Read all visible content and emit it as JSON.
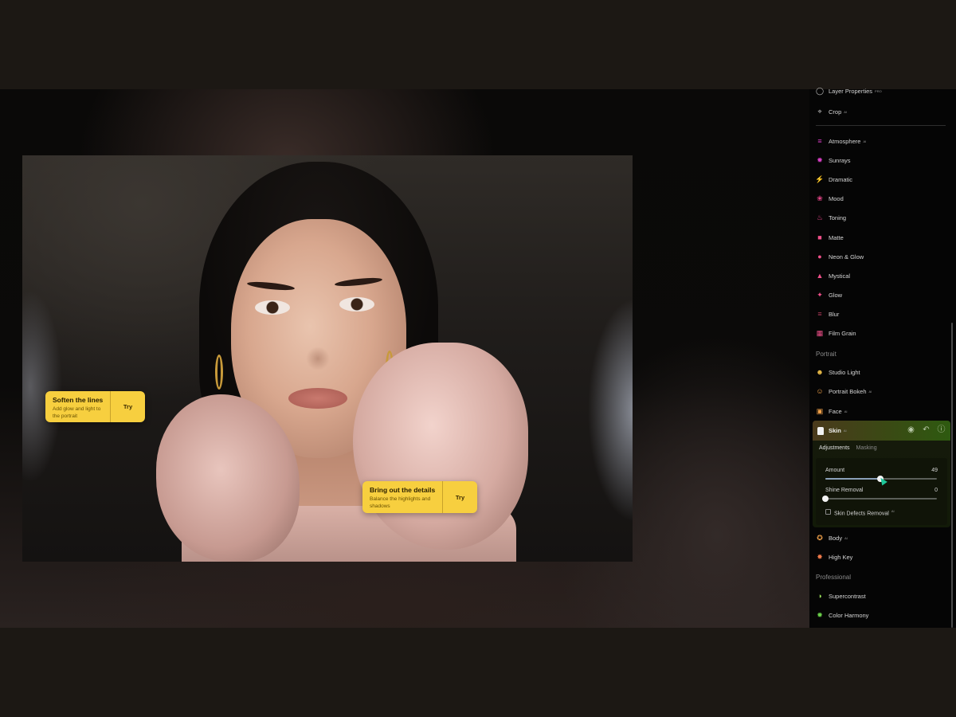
{
  "canvas": {
    "photo_alt": "Portrait of a woman with dark hair and a pink tulle ruffle dress"
  },
  "suggestions": [
    {
      "title": "Soften the lines",
      "description": "Add glow and light to the portrait",
      "action": "Try"
    },
    {
      "title": "Bring out the details",
      "description": "Balance the highlights and shadows",
      "action": "Try"
    }
  ],
  "panel": {
    "top_items": [
      {
        "label": "Layer Properties",
        "badge": "PRO",
        "icon": "layer-properties-icon",
        "color": "#bfbfbf"
      },
      {
        "label": "Crop",
        "badge": "AI",
        "icon": "crop-icon",
        "color": "#bfbfbf"
      }
    ],
    "creative_items": [
      {
        "label": "Atmosphere",
        "badge": "AI",
        "icon": "atmosphere-icon",
        "color": "#d63fc4"
      },
      {
        "label": "Sunrays",
        "badge": "",
        "icon": "sunrays-icon",
        "color": "#d63fc4"
      },
      {
        "label": "Dramatic",
        "badge": "",
        "icon": "dramatic-icon",
        "color": "#e8468a"
      },
      {
        "label": "Mood",
        "badge": "",
        "icon": "mood-icon",
        "color": "#e8468a"
      },
      {
        "label": "Toning",
        "badge": "",
        "icon": "toning-icon",
        "color": "#e8468a"
      },
      {
        "label": "Matte",
        "badge": "",
        "icon": "matte-icon",
        "color": "#f0508a"
      },
      {
        "label": "Neon & Glow",
        "badge": "",
        "icon": "neon-glow-icon",
        "color": "#f0508a"
      },
      {
        "label": "Mystical",
        "badge": "",
        "icon": "mystical-icon",
        "color": "#f0508a"
      },
      {
        "label": "Glow",
        "badge": "",
        "icon": "glow-icon",
        "color": "#f0508a"
      },
      {
        "label": "Blur",
        "badge": "",
        "icon": "blur-icon",
        "color": "#b03a5a"
      },
      {
        "label": "Film Grain",
        "badge": "",
        "icon": "film-grain-icon",
        "color": "#f0508a"
      }
    ],
    "portrait_section": "Portrait",
    "portrait_items": [
      {
        "label": "Studio Light",
        "badge": "",
        "icon": "studio-light-icon",
        "color": "#f2c24a"
      },
      {
        "label": "Portrait Bokeh",
        "badge": "AI",
        "icon": "portrait-bokeh-icon",
        "color": "#f2a24a"
      },
      {
        "label": "Face",
        "badge": "AI",
        "icon": "face-icon",
        "color": "#f2a24a"
      }
    ],
    "skin": {
      "label": "Skin",
      "badge": "AI",
      "tabs": [
        "Adjustments",
        "Masking"
      ],
      "active_tab": "Adjustments",
      "amount_label": "Amount",
      "amount_value": "49",
      "amount_fraction": 0.49,
      "shine_label": "Shine Removal",
      "shine_value": "0",
      "shine_fraction": 0,
      "defects_label": "Skin Defects Removal",
      "defects_badge": "AI",
      "defects_checked": false
    },
    "portrait_items_after": [
      {
        "label": "Body",
        "badge": "AI",
        "icon": "body-icon",
        "color": "#f2a24a"
      },
      {
        "label": "High Key",
        "badge": "",
        "icon": "high-key-icon",
        "color": "#f07a4a"
      }
    ],
    "professional_section": "Professional",
    "professional_items": [
      {
        "label": "Supercontrast",
        "badge": "",
        "icon": "supercontrast-icon",
        "color": "#9ae05a"
      },
      {
        "label": "Color Harmony",
        "badge": "",
        "icon": "color-harmony-icon",
        "color": "#6ad04a"
      }
    ]
  }
}
